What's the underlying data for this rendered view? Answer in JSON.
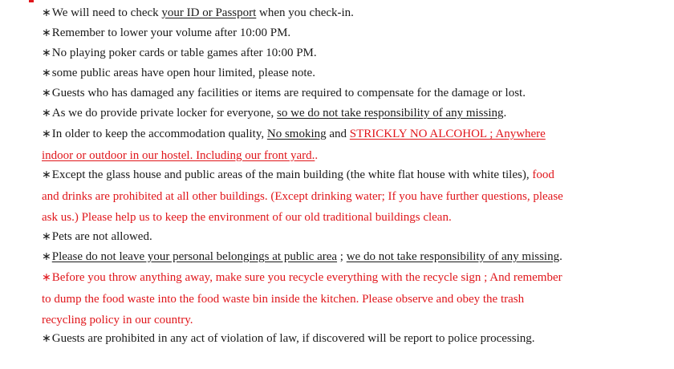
{
  "bullet": "∗",
  "rules": [
    {
      "pre": "We will need to check ",
      "u": "your ID or Passport",
      "post": " when you check-in."
    },
    {
      "text": "Remember to lower your volume after 10:00 PM."
    },
    {
      "text": "No playing poker cards or table games after 10:00 PM."
    },
    {
      "text": "some public areas have open hour limited, please note."
    },
    {
      "text": "Guests who has damaged any facilities  or items are required to compensate for the damage or lost."
    },
    {
      "pre": "As we do provide private locker for everyone, ",
      "u": "so we do not take responsibility  of any missing",
      "post": "."
    },
    {
      "pre": "In older to keep the accommodation quality, ",
      "u": "No smoking",
      "mid": " and ",
      "red_u": "STRICKLY NO ALCOHOL ; Anywhere",
      "line2_red_u": "indoor or outdoor in our hostel. Including our front yard.",
      "line2_post": "."
    },
    {
      "pre": "Except the glass house and public areas of the main building (the white flat house with white tiles), ",
      "red": "food",
      "line2_red": "and drinks are prohibited at all other buildings.  (Except drinking water; If you have further questions, please",
      "line3_red": "ask us.) Please help us to keep the environment of our old traditional buildings clean."
    },
    {
      "text": "Pets are not allowed."
    },
    {
      "u": "Please do not leave your personal belongings at public area",
      "mid": " ; ",
      "u2": "we do not take responsibility  of any missing",
      "post": "."
    },
    {
      "red": "Before you throw anything away, make sure you recycle everything with the recycle sign ; And remember",
      "line2_red": "to dump the food waste into the food waste bin inside the kitchen. Please observe and obey the trash",
      "line3_red": "recycling policy in our country."
    },
    {
      "text": "Guests are prohibited in any act of violation of law, if discovered will be report to police processing."
    }
  ],
  "colors": {
    "red": "#e0161b",
    "text": "#1a1a1a"
  }
}
